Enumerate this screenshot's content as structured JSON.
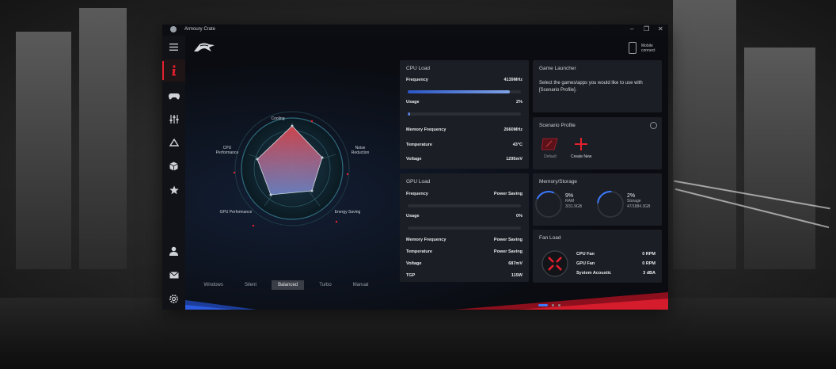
{
  "window": {
    "title": "Armoury Crate"
  },
  "header": {
    "mobile_connect_label": "Mobile connect"
  },
  "sidebar": {
    "items": [
      {
        "name": "menu-icon"
      },
      {
        "name": "info-icon"
      },
      {
        "name": "gamepad-icon"
      },
      {
        "name": "sliders-icon"
      },
      {
        "name": "aura-triangle-icon"
      },
      {
        "name": "cube-icon"
      },
      {
        "name": "star-icon"
      },
      {
        "name": "user-icon"
      },
      {
        "name": "mail-icon"
      },
      {
        "name": "gear-icon"
      }
    ]
  },
  "radar": {
    "labels": {
      "cooling": "Cooling",
      "noise": "Noise Reduction",
      "energy": "Energy Saving",
      "gpu": "GPU Performance",
      "cpu": "CPU Performance"
    }
  },
  "modes": {
    "items": [
      "Windows",
      "Silent",
      "Balanced",
      "Turbo",
      "Manual"
    ],
    "active": "Balanced"
  },
  "cpu_load": {
    "title": "CPU Load",
    "frequency_label": "Frequency",
    "frequency_value": "4139MHz",
    "frequency_level": 0.9,
    "usage_label": "Usage",
    "usage_value": "2%",
    "usage_level": 0.02,
    "mem_freq_label": "Memory Frequency",
    "mem_freq_value": "2660MHz",
    "temperature_label": "Temperature",
    "temperature_value": "43°C",
    "voltage_label": "Voltage",
    "voltage_value": "1295mV"
  },
  "gpu_load": {
    "title": "GPU Load",
    "frequency_label": "Frequency",
    "frequency_value": "Power Saving",
    "usage_label": "Usage",
    "usage_value": "0%",
    "mem_freq_label": "Memory Frequency",
    "mem_freq_value": "Power Saving",
    "temperature_label": "Temperature",
    "temperature_value": "Power Saving",
    "voltage_label": "Voltage",
    "voltage_value": "687mV",
    "tgp_label": "TGP",
    "tgp_value": "115W"
  },
  "game_launcher": {
    "title": "Game Launcher",
    "description": "Select the games/apps you would like to use with [Scenario Profile]."
  },
  "scenario_profile": {
    "title": "Scenario Profile",
    "default_label": "Default",
    "create_label": "Create New"
  },
  "memory_storage": {
    "title": "Memory/Storage",
    "ram_percent": "9%",
    "ram_label": "RAM",
    "ram_detail": "3/31.9GB",
    "storage_percent": "2%",
    "storage_label": "Storage",
    "storage_detail": "47/1884.3GB"
  },
  "fan_load": {
    "title": "Fan Load",
    "cpu_fan_label": "CPU Fan",
    "cpu_fan_value": "0 RPM",
    "gpu_fan_label": "GPU Fan",
    "gpu_fan_value": "0 RPM",
    "acoustic_label": "System Acoustic",
    "acoustic_value": "3 dBA"
  },
  "pager": {
    "count": 3,
    "active": 0
  },
  "colors": {
    "accent": "#3b79ff",
    "brand_red": "#e4202f"
  }
}
